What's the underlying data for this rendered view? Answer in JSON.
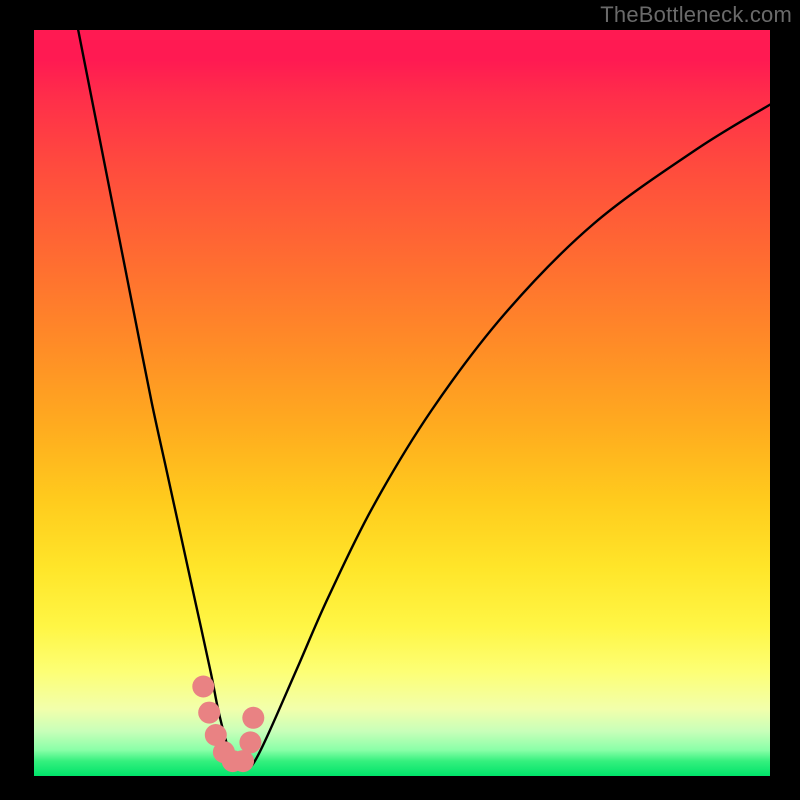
{
  "watermark": "TheBottleneck.com",
  "chart_data": {
    "type": "line",
    "title": "",
    "xlabel": "",
    "ylabel": "",
    "xlim": [
      0,
      100
    ],
    "ylim": [
      0,
      100
    ],
    "grid": false,
    "legend": false,
    "background_gradient": {
      "top_color": "#ff1a52",
      "bottom_color": "#00e36a",
      "meaning": "red_high_bottleneck_to_green_low_bottleneck"
    },
    "series": [
      {
        "name": "bottleneck-curve",
        "color": "#000000",
        "x": [
          6,
          8,
          10,
          12,
          14,
          16,
          18,
          20,
          22,
          24,
          25,
          26,
          27,
          28,
          29,
          30,
          32,
          36,
          40,
          46,
          54,
          64,
          76,
          90,
          100
        ],
        "y": [
          100,
          90,
          80,
          70,
          60,
          50,
          41,
          32,
          23,
          14,
          9,
          5,
          2,
          1,
          1,
          2,
          6,
          15,
          24,
          36,
          49,
          62,
          74,
          84,
          90
        ],
        "note": "V-shaped bottleneck curve; minimum near x≈27–28"
      },
      {
        "name": "optimal-region-marker",
        "type": "marker-cluster",
        "color": "#e98283",
        "x": [
          23.0,
          23.8,
          24.7,
          25.8,
          27.0,
          28.4,
          29.4,
          29.8
        ],
        "y": [
          12.0,
          8.5,
          5.5,
          3.2,
          2.0,
          2.0,
          4.5,
          7.8
        ],
        "note": "chunky salmon dots tracing the trough of the V"
      }
    ]
  }
}
